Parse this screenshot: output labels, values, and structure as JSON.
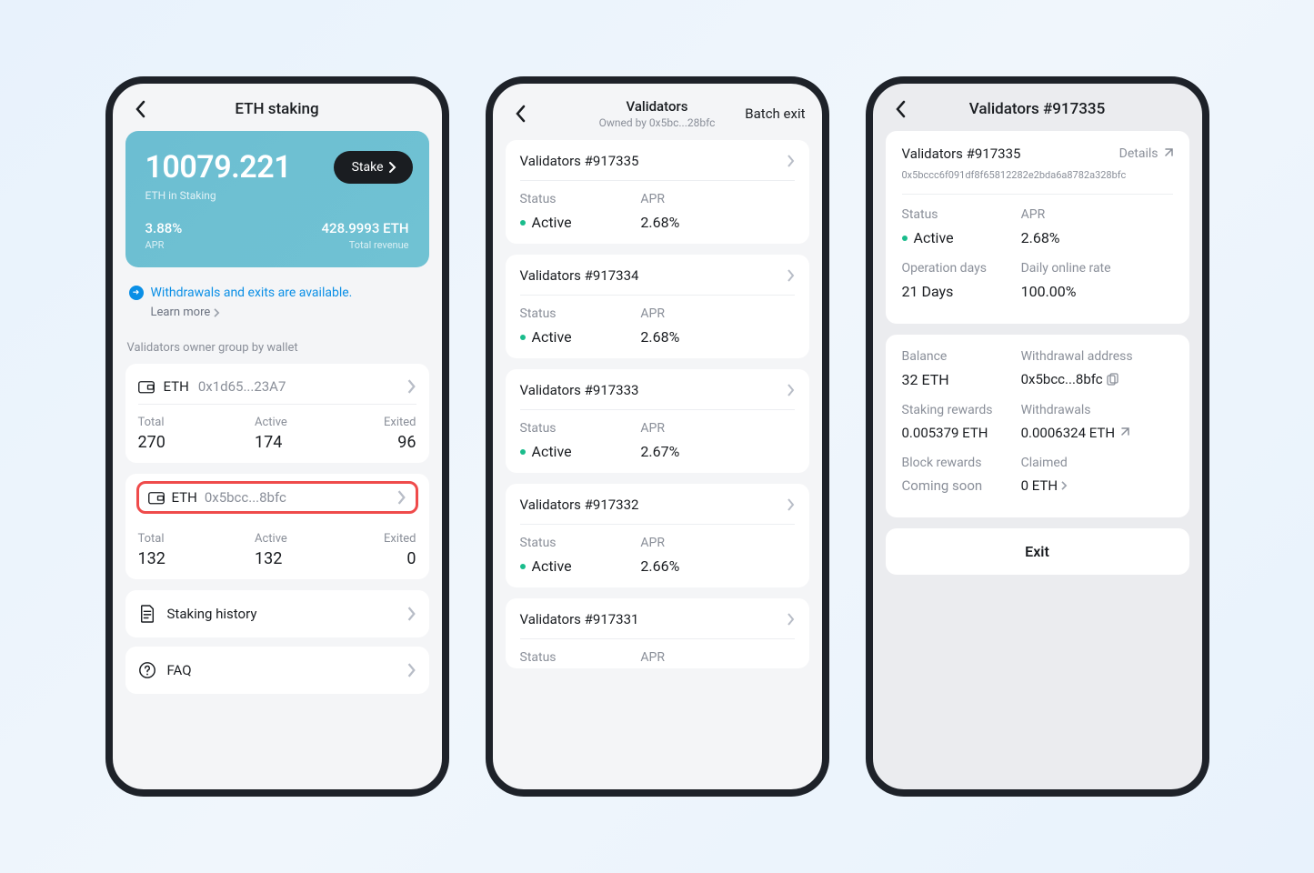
{
  "screen1": {
    "title": "ETH staking",
    "amount": "10079.221",
    "amount_label": "ETH in Staking",
    "stake_btn": "Stake",
    "apr": "3.88%",
    "apr_label": "APR",
    "revenue": "428.9993 ETH",
    "revenue_label": "Total revenue",
    "notice": "Withdrawals and exits are available.",
    "learn_more": "Learn more",
    "section_label": "Validators owner group by wallet",
    "wallets": [
      {
        "name": "ETH",
        "addr": "0x1d65...23A7",
        "total": "270",
        "active": "174",
        "exited": "96"
      },
      {
        "name": "ETH",
        "addr": "0x5bcc...8bfc",
        "total": "132",
        "active": "132",
        "exited": "0"
      }
    ],
    "labels": {
      "total": "Total",
      "active": "Active",
      "exited": "Exited"
    },
    "links": {
      "history": "Staking history",
      "faq": "FAQ"
    }
  },
  "screen2": {
    "title": "Validators",
    "subtitle": "Owned by 0x5bc...28bfc",
    "action": "Batch exit",
    "labels": {
      "status": "Status",
      "apr": "APR",
      "active": "Active"
    },
    "items": [
      {
        "id": "Validators  #917335",
        "apr": "2.68%"
      },
      {
        "id": "Validators  #917334",
        "apr": "2.68%"
      },
      {
        "id": "Validators  #917333",
        "apr": "2.67%"
      },
      {
        "id": "Validators  #917332",
        "apr": "2.66%"
      },
      {
        "id": "Validators  #917331",
        "apr": ""
      }
    ]
  },
  "screen3": {
    "title": "Validators #917335",
    "card_title": "Validators  #917335",
    "details_label": "Details",
    "hash": "0x5bccc6f091df8f65812282e2bda6a8782a328bfc",
    "labels": {
      "status": "Status",
      "apr": "APR",
      "active": "Active",
      "op_days": "Operation days",
      "online_rate": "Daily online rate",
      "balance": "Balance",
      "waddr": "Withdrawal address",
      "srewards": "Staking rewards",
      "withdrawals": "Withdrawals",
      "brewards": "Block rewards",
      "claimed": "Claimed"
    },
    "values": {
      "apr": "2.68%",
      "op_days": "21 Days",
      "online_rate": "100.00%",
      "balance": "32 ETH",
      "waddr": "0x5bcc...8bfc",
      "srewards": "0.005379 ETH",
      "withdrawals": "0.0006324 ETH",
      "brewards": "Coming soon",
      "claimed": "0 ETH"
    },
    "exit_btn": "Exit"
  }
}
